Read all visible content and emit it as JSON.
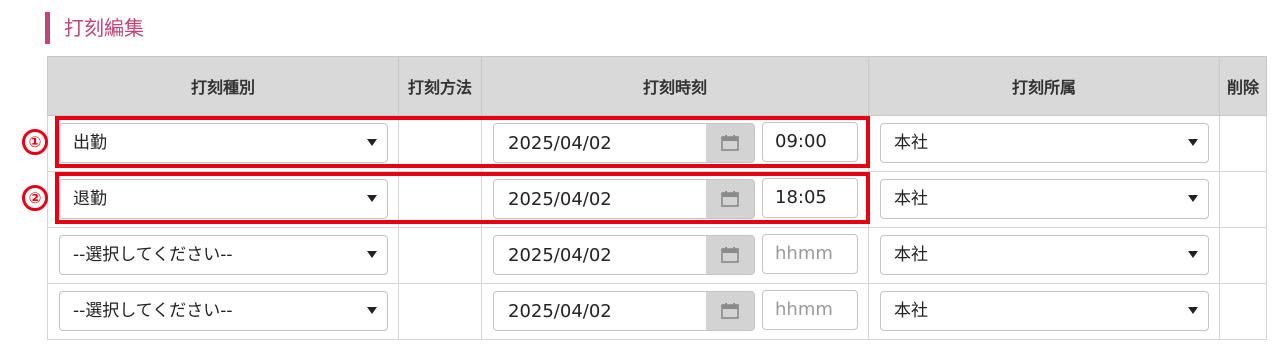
{
  "section_title": "打刻編集",
  "table": {
    "headers": [
      "打刻種別",
      "打刻方法",
      "打刻時刻",
      "打刻所属",
      "削除"
    ],
    "rows": [
      {
        "type": "出勤",
        "method": "",
        "date": "2025/04/02",
        "time": "09:00",
        "time_placeholder": "",
        "dept": "本社"
      },
      {
        "type": "退勤",
        "method": "",
        "date": "2025/04/02",
        "time": "18:05",
        "time_placeholder": "",
        "dept": "本社"
      },
      {
        "type": "--選択してください--",
        "method": "",
        "date": "2025/04/02",
        "time": "",
        "time_placeholder": "hhmm",
        "dept": "本社"
      },
      {
        "type": "--選択してください--",
        "method": "",
        "date": "2025/04/02",
        "time": "",
        "time_placeholder": "hhmm",
        "dept": "本社"
      }
    ]
  },
  "annotations": {
    "markers": [
      "①",
      "②"
    ],
    "highlight_color": "#e60012"
  },
  "colors": {
    "accent": "#c0467a",
    "header_bg": "#d9d9d9",
    "calendar_button_bg": "#d3d3d3"
  },
  "icons": {
    "date_picker": "calendar-icon",
    "select": "chevron-down-icon"
  }
}
